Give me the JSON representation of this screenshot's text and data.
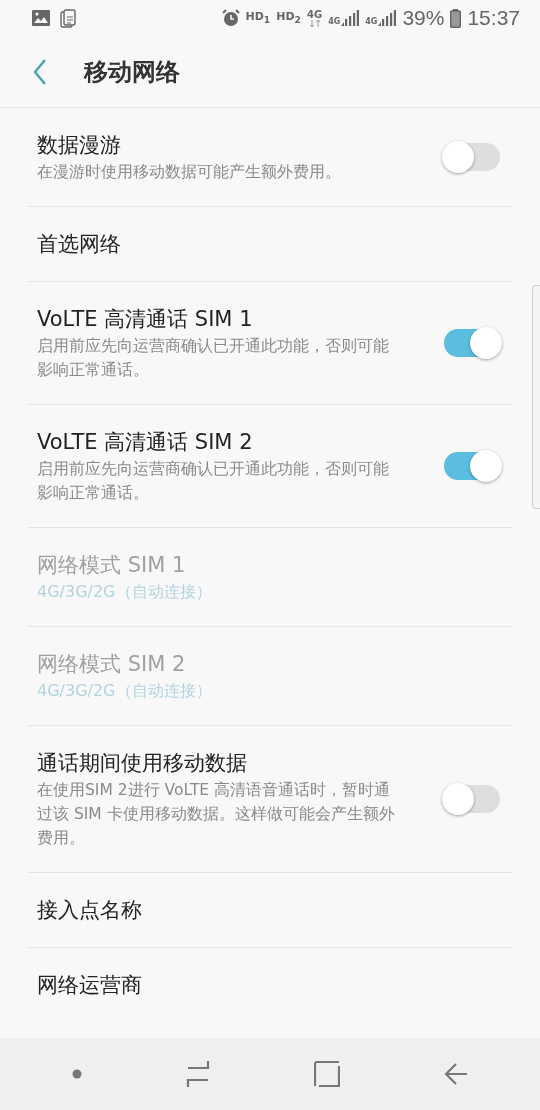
{
  "status_bar": {
    "hd": [
      "HD$_{1}$",
      "HD$_{2}$"
    ],
    "network": "4G",
    "signals": [
      {
        "label": "4G"
      },
      {
        "label": "4G"
      }
    ],
    "battery": "39%",
    "time": "15:37"
  },
  "toolbar": {
    "title": "移动网络"
  },
  "settings": [
    {
      "kind": "switch",
      "title": "数据漫游",
      "summary": "在漫游时使用移动数据可能产生额外费用。",
      "on": false,
      "disabled": false
    },
    {
      "kind": "plain",
      "title": "首选网络",
      "disabled": false
    },
    {
      "kind": "switch",
      "title": "VoLTE 高清通话 SIM 1",
      "summary": "启用前应先向运营商确认已开通此功能，否则可能影响正常通话。",
      "on": true,
      "disabled": false
    },
    {
      "kind": "switch",
      "title": "VoLTE 高清通话 SIM 2",
      "summary": "启用前应先向运营商确认已开通此功能，否则可能影响正常通话。",
      "on": true,
      "disabled": false
    },
    {
      "kind": "value",
      "title": "网络模式 SIM 1",
      "value": "4G/3G/2G（自动连接）",
      "disabled": true
    },
    {
      "kind": "value",
      "title": "网络模式 SIM 2",
      "value": "4G/3G/2G（自动连接）",
      "disabled": true
    },
    {
      "kind": "switch",
      "title": "通话期间使用移动数据",
      "summary": "在使用SIM 2进行 VoLTE 高清语音通话时，暂时通过该 SIM 卡使用移动数据。这样做可能会产生额外费用。",
      "on": false,
      "disabled": false
    },
    {
      "kind": "plain",
      "title": "接入点名称",
      "disabled": false
    },
    {
      "kind": "plain",
      "title": "网络运营商",
      "disabled": false
    }
  ]
}
